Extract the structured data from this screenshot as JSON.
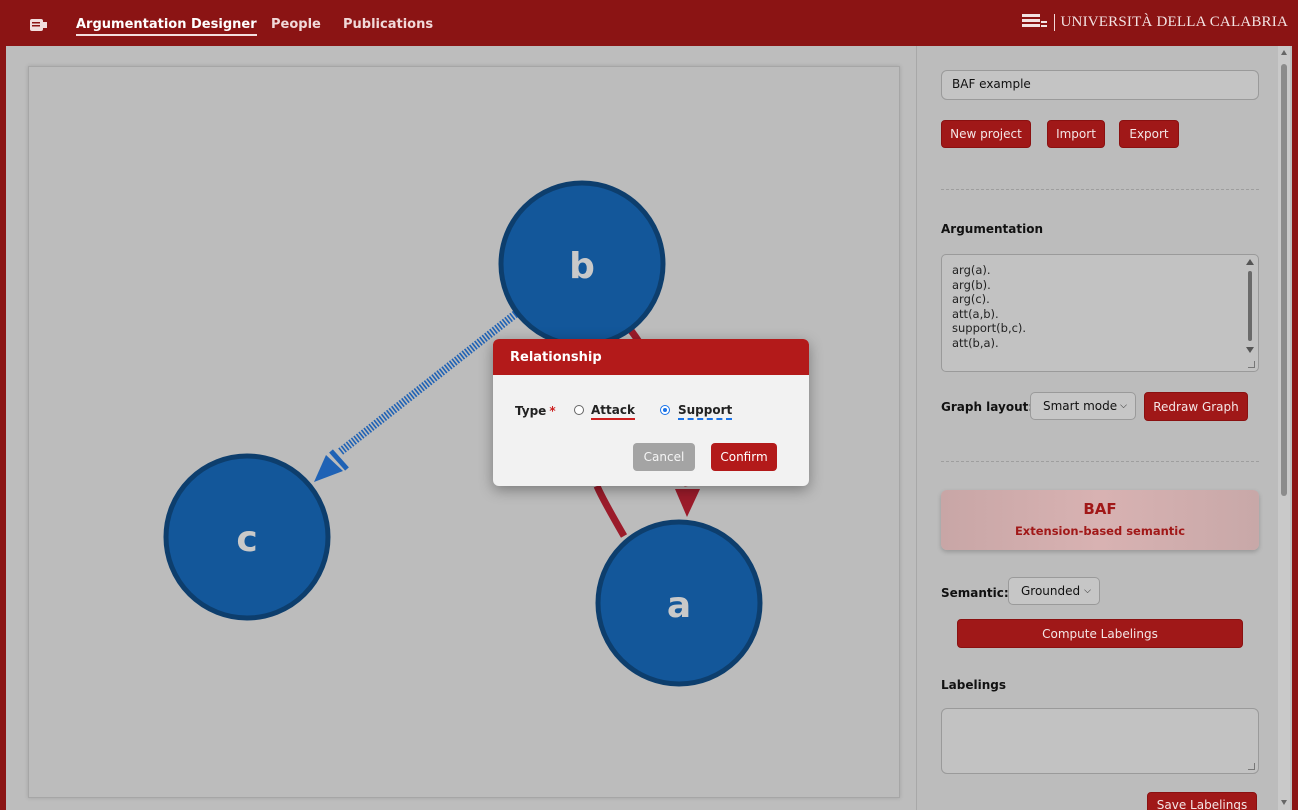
{
  "navbar": {
    "links": [
      "Argumentation Designer",
      "People",
      "Publications"
    ],
    "university": "UNIVERSITÀ DELLA CALABRIA"
  },
  "graph": {
    "nodes": [
      "b",
      "c",
      "a"
    ],
    "node_color": "#13579a",
    "attack_color": "#9b1b2a",
    "support_color": "#1f62b5"
  },
  "sidebar": {
    "project_name": "BAF example",
    "buttons": {
      "new_project": "New project",
      "import": "Import",
      "export": "Export"
    },
    "argumentation_label": "Argumentation",
    "argumentation_lines": [
      "arg(a).",
      "arg(b).",
      "arg(c).",
      "att(a,b).",
      "support(b,c).",
      "att(b,a)."
    ],
    "graph_layout_label": "Graph layout:",
    "graph_layout_value": "Smart mode",
    "redraw_button": "Redraw Graph",
    "framework_title": "BAF",
    "framework_subtitle": "Extension-based semantic",
    "semantic_label": "Semantic:",
    "semantic_value": "Grounded",
    "compute_button": "Compute Labelings",
    "labelings_label": "Labelings",
    "save_button": "Save Labelings"
  },
  "modal": {
    "title": "Relationship",
    "type_label": "Type",
    "required_mark": "*",
    "option_attack": "Attack",
    "option_support": "Support",
    "selected": "Support",
    "cancel": "Cancel",
    "confirm": "Confirm"
  },
  "colors": {
    "brand": "#8b1414",
    "accent": "#b31a1a",
    "support": "#1a73e8"
  }
}
